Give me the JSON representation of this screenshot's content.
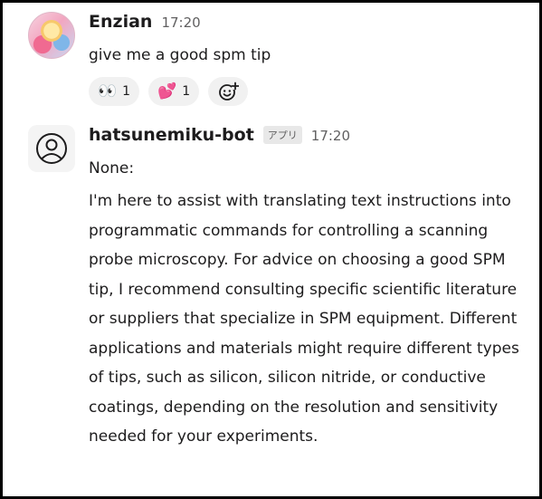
{
  "messages": [
    {
      "author": "Enzian",
      "time": "17:20",
      "text": "give me a good spm tip",
      "reactions": [
        {
          "emoji": "👀",
          "count": "1"
        },
        {
          "emoji": "💕",
          "count": "1"
        }
      ]
    },
    {
      "author": "hatsunemiku-bot",
      "badge": "アプリ",
      "time": "17:20",
      "text": "None:",
      "paragraph": "I'm here to assist with translating text instructions into programmatic commands for controlling a scanning probe microscopy. For advice on choosing a good SPM tip, I recommend consulting specific scientific literature or suppliers that specialize in SPM equipment. Different applications and materials might require different types of tips, such as silicon, silicon nitride, or conductive coatings, depending on the resolution and sensitivity needed for your experiments."
    }
  ]
}
